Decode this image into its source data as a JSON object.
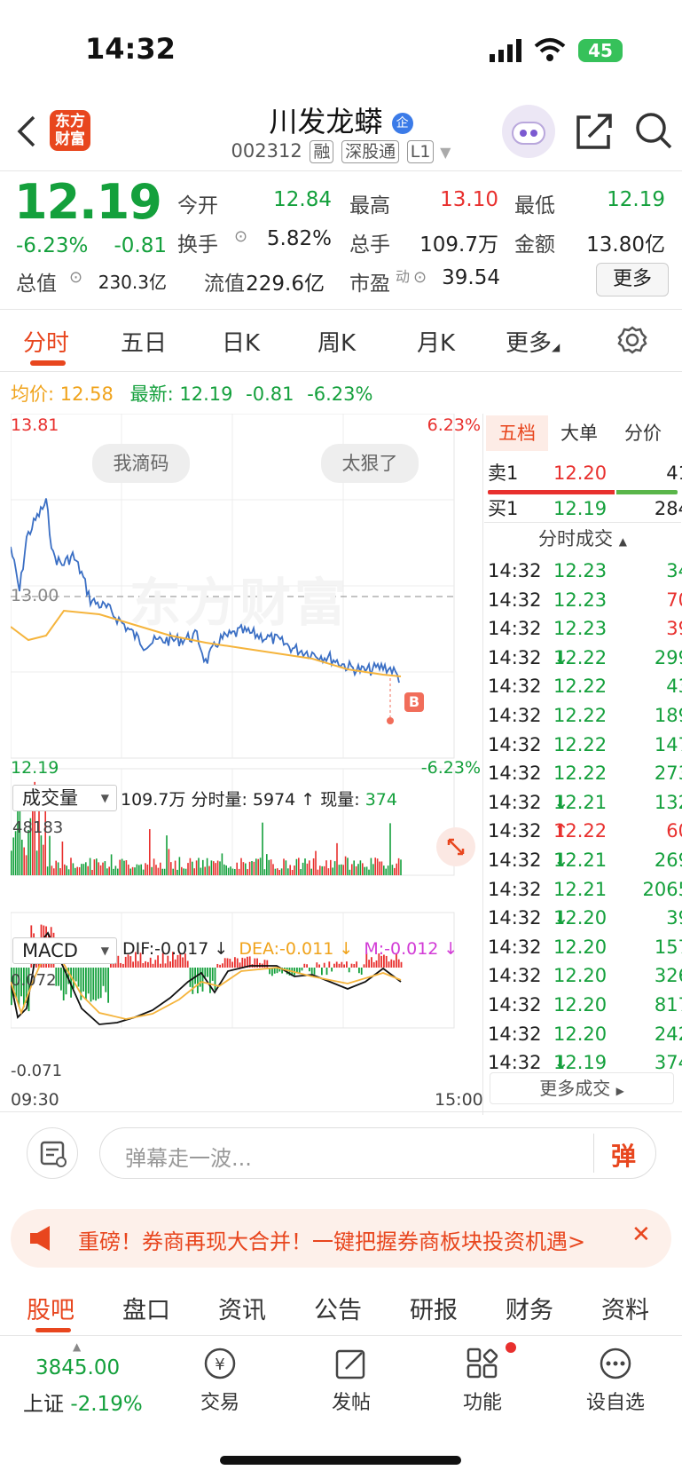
{
  "status_bar": {
    "time": "14:32",
    "battery": "45"
  },
  "header": {
    "logo_text": "东方财富",
    "title": "川发龙蟒",
    "title_badge": "企",
    "code": "002312",
    "tags": [
      "融",
      "深股通",
      "L1"
    ]
  },
  "quote": {
    "price": "12.19",
    "change_pct": "-6.23%",
    "change": "-0.81",
    "fields": [
      {
        "label": "今开",
        "value": "12.84",
        "color": "#14a03c"
      },
      {
        "label": "最高",
        "value": "13.10",
        "color": "#e8302e"
      },
      {
        "label": "最低",
        "value": "12.19",
        "color": "#14a03c"
      },
      {
        "label": "换手",
        "value": "5.82%",
        "color": "#222222"
      },
      {
        "label": "总手",
        "value": "109.7万",
        "color": "#222222"
      },
      {
        "label": "金额",
        "value": "13.80亿",
        "color": "#222222"
      },
      {
        "label": "总值",
        "value": "230.3亿",
        "color": "#222222"
      },
      {
        "label": "流值",
        "value": "229.6亿",
        "color": "#222222"
      },
      {
        "label": "市盈",
        "value": "39.54",
        "color": "#222222"
      }
    ],
    "pe_sup": "动",
    "more_button": "更多"
  },
  "tabs": [
    "分时",
    "五日",
    "日K",
    "周K",
    "月K",
    "更多"
  ],
  "avg_line": {
    "avg_label": "均价:",
    "avg_value": "12.58",
    "last_label": "最新:",
    "last_value": "12.19",
    "last_change": "-0.81",
    "last_pct": "-6.23%"
  },
  "chart": {
    "y_top": "13.81",
    "y_bottom": "12.19",
    "pct_top": "6.23%",
    "pct_bottom": "-6.23%",
    "ref_line": "13.00",
    "chips": [
      "我滴码",
      "太狠了"
    ],
    "buy_marker": "B",
    "watermark": "东方财富",
    "vol_select": "成交量",
    "vol_total": "109.7万",
    "vol_fenshi": "分时量: 5974 ↑",
    "vol_now_label": "现量:",
    "vol_now": "374",
    "vol_max": "48183",
    "macd_select": "MACD",
    "dif": "DIF:-0.017 ↓",
    "dea": "DEA:-0.011 ↓",
    "m": "M:-0.012 ↓",
    "macd_top": "0.072",
    "macd_bottom": "-0.071",
    "time_start": "09:30",
    "time_end": "15:00",
    "colors": {
      "price": "#3b6fc4",
      "avg": "#f5b43c",
      "up": "#e8302e",
      "down": "#14a03c"
    }
  },
  "order_book": {
    "tabs": [
      "五档",
      "大单",
      "分价"
    ],
    "ask": {
      "label": "卖1",
      "price": "12.20",
      "volume": "41"
    },
    "bid": {
      "label": "买1",
      "price": "12.19",
      "volume": "284"
    },
    "trades_title": "分时成交",
    "trades": [
      {
        "time": "14:32",
        "price": "12.23",
        "arrow": "",
        "vol": "34",
        "color": "#14a03c"
      },
      {
        "time": "14:32",
        "price": "12.23",
        "arrow": "",
        "vol": "70",
        "color": "#e8302e"
      },
      {
        "time": "14:32",
        "price": "12.23",
        "arrow": "",
        "vol": "39",
        "color": "#e8302e"
      },
      {
        "time": "14:32",
        "price": "12.22",
        "arrow": "↓",
        "vol": "299",
        "color": "#14a03c"
      },
      {
        "time": "14:32",
        "price": "12.22",
        "arrow": "",
        "vol": "43",
        "color": "#14a03c"
      },
      {
        "time": "14:32",
        "price": "12.22",
        "arrow": "",
        "vol": "189",
        "color": "#14a03c"
      },
      {
        "time": "14:32",
        "price": "12.22",
        "arrow": "",
        "vol": "147",
        "color": "#14a03c"
      },
      {
        "time": "14:32",
        "price": "12.22",
        "arrow": "",
        "vol": "273",
        "color": "#14a03c"
      },
      {
        "time": "14:32",
        "price": "12.21",
        "arrow": "↓",
        "vol": "132",
        "color": "#14a03c"
      },
      {
        "time": "14:32",
        "price": "12.22",
        "arrow": "↑",
        "vol": "60",
        "color": "#e8302e"
      },
      {
        "time": "14:32",
        "price": "12.21",
        "arrow": "↓",
        "vol": "269",
        "color": "#14a03c"
      },
      {
        "time": "14:32",
        "price": "12.21",
        "arrow": "",
        "vol": "2065",
        "color": "#14a03c"
      },
      {
        "time": "14:32",
        "price": "12.20",
        "arrow": "↓",
        "vol": "39",
        "color": "#14a03c"
      },
      {
        "time": "14:32",
        "price": "12.20",
        "arrow": "",
        "vol": "157",
        "color": "#14a03c"
      },
      {
        "time": "14:32",
        "price": "12.20",
        "arrow": "",
        "vol": "326",
        "color": "#14a03c"
      },
      {
        "time": "14:32",
        "price": "12.20",
        "arrow": "",
        "vol": "817",
        "color": "#14a03c"
      },
      {
        "time": "14:32",
        "price": "12.20",
        "arrow": "",
        "vol": "242",
        "color": "#14a03c"
      },
      {
        "time": "14:32",
        "price": "12.19",
        "arrow": "↓",
        "vol": "374",
        "color": "#14a03c"
      }
    ],
    "more_trades": "更多成交"
  },
  "comment": {
    "placeholder": "弹幕走一波...",
    "danmu": "弹"
  },
  "banner": {
    "text": "重磅！券商再现大合并！一键把握券商板块投资机遇>"
  },
  "bottom_tabs": [
    "股吧",
    "盘口",
    "资讯",
    "公告",
    "研报",
    "财务",
    "资料"
  ],
  "bottom_nav": {
    "index_value": "3845.00",
    "index_name": "上证",
    "index_change": "-2.19%",
    "items": [
      "交易",
      "发帖",
      "功能",
      "设自选"
    ]
  }
}
